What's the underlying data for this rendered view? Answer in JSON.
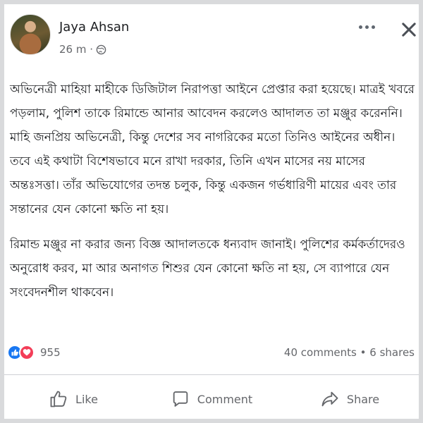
{
  "post": {
    "author": "Jaya Ahsan",
    "time": "26 m ·",
    "paragraphs": [
      "অভিনেত্রী মাহিয়া মাহীকে ডিজিটাল নিরাপত্তা আইনে প্রেপ্তার করা হয়েছে। মাত্রই খবরে পড়লাম, পুলিশ তাকে রিমান্ডে আনার আবেদন করলেও আদালত তা মঞ্জুর করেননি। মাহি জনপ্রিয় অভিনেত্রী, কিন্তু দেশের সব নাগরিকের মতো তিনিও আইনের অধীন। তবে এই কথাটা বিশেষভাবে মনে রাখা দরকার, তিনি এখন মাসের নয় মাসের অন্তঃসত্তা। তাঁর অভিযোগের তদন্ত চলুক, কিন্তু একজন গর্ভধারিণী মায়ের এবং তার সন্তানের যেন কোনো ক্ষতি না হয়।",
      "রিমান্ড মঞ্জুর না করার জন্য বিজ্ঞ আদালতকে ধন্যবাদ জানাই। পুলিশের কর্মকর্তাদেরও অনুরোধ করব, মা আর অনাগত শিশুর যেন কোনো ক্ষতি না হয়, সে ব্যাপারে যেন সংবেদনশীল থাকবেন।"
    ]
  },
  "stats": {
    "reactions": "955",
    "comments": "40 comments",
    "separator": "•",
    "shares": "6 shares"
  },
  "actions": {
    "like": "Like",
    "comment": "Comment",
    "share": "Share"
  },
  "icons": [
    "globe-icon",
    "more-icon",
    "close-icon",
    "like-reaction-icon",
    "love-reaction-icon",
    "like-icon",
    "comment-icon",
    "share-icon"
  ],
  "colors": {
    "like_blue": "#1877f2",
    "love_red": "#f33e58",
    "text": "#1c1e21",
    "secondary": "#65676b"
  }
}
